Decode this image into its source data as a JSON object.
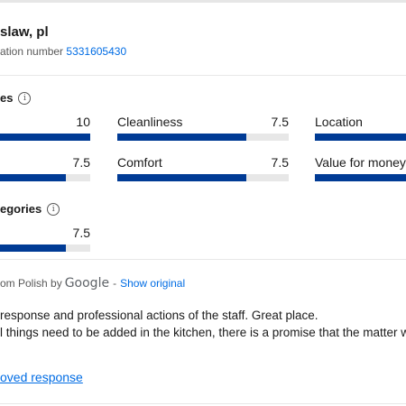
{
  "header": {
    "location": "slaw, pl",
    "reservation_label": "ation number",
    "reservation_number": "5331605430"
  },
  "scores_section": {
    "title": "es",
    "info_icon": "info-icon"
  },
  "scores": [
    {
      "label": "",
      "value": "10",
      "fraction": 1.0
    },
    {
      "label": "Cleanliness",
      "value": "7.5",
      "fraction": 0.75
    },
    {
      "label": "Location",
      "value": "",
      "fraction": 1.0
    },
    {
      "label": "",
      "value": "7.5",
      "fraction": 0.75
    },
    {
      "label": "Comfort",
      "value": "7.5",
      "fraction": 0.75
    },
    {
      "label": "Value for money",
      "value": "",
      "fraction": 1.0
    }
  ],
  "categories_section": {
    "title": "egories",
    "info_icon": "info-icon"
  },
  "category_scores": [
    {
      "label": "",
      "value": "7.5",
      "fraction": 0.75
    }
  ],
  "translation": {
    "prefix": "om Polish by",
    "provider": "Google",
    "separator": "-",
    "show_original": "Show original"
  },
  "review": {
    "line1": "response and professional actions of the staff. Great place.",
    "line2": "l things need to be added in the kitchen, there is a promise that the matter w"
  },
  "approved_link": "oved response",
  "colors": {
    "bar_fill": "#003b95",
    "bar_track": "#e7e7e7",
    "link": "#006ce4"
  }
}
